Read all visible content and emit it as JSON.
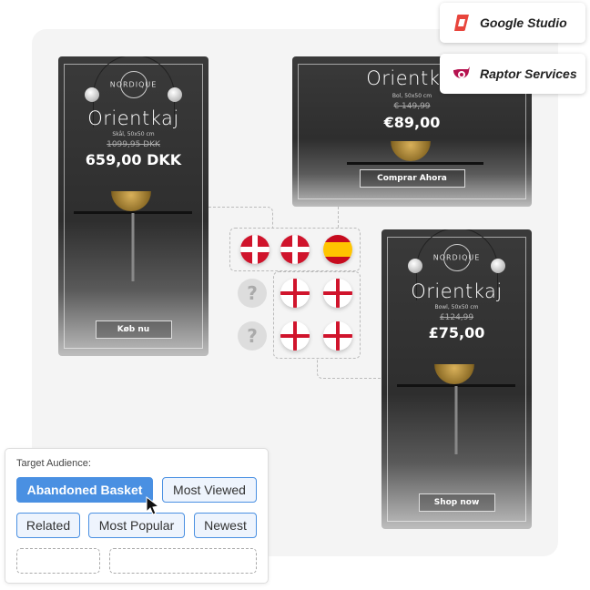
{
  "brands": [
    {
      "name": "Google Studio",
      "icon": "google-studio-logo",
      "color": "#e8453c"
    },
    {
      "name": "Raptor Services",
      "icon": "raptor-logo",
      "color": "#b5124f"
    }
  ],
  "banners": [
    {
      "logo": "NORDIQUE",
      "title": "Orientkaj",
      "subtitle": "Skål, 50x50 cm",
      "old_price": "1099,95 DKK",
      "price": "659,00 DKK",
      "cta": "Køb nu"
    },
    {
      "title": "Orientkaj",
      "subtitle": "Bol, 50x50 cm",
      "old_price": "€ 149,99",
      "price": "€89,00",
      "cta": "Comprar Ahora"
    },
    {
      "logo": "NORDIQUE",
      "title": "Orientkaj",
      "subtitle": "Bowl, 50x50 cm",
      "old_price": "£124,99",
      "price": "£75,00",
      "cta": "Shop now"
    }
  ],
  "flags": {
    "question_mark": "?",
    "grid": [
      [
        "denmark",
        "denmark",
        "spain"
      ],
      [
        "unknown",
        "england",
        "england"
      ],
      [
        "unknown",
        "england",
        "england"
      ]
    ]
  },
  "audience": {
    "label": "Target Audience:",
    "chips": [
      {
        "label": "Abandoned Basket",
        "selected": true
      },
      {
        "label": "Most Viewed",
        "selected": false
      },
      {
        "label": "Related",
        "selected": false
      },
      {
        "label": "Most Popular",
        "selected": false
      },
      {
        "label": "Newest",
        "selected": false
      }
    ]
  },
  "colors": {
    "accent": "#4a90e2",
    "panel": "#f4f4f4"
  }
}
